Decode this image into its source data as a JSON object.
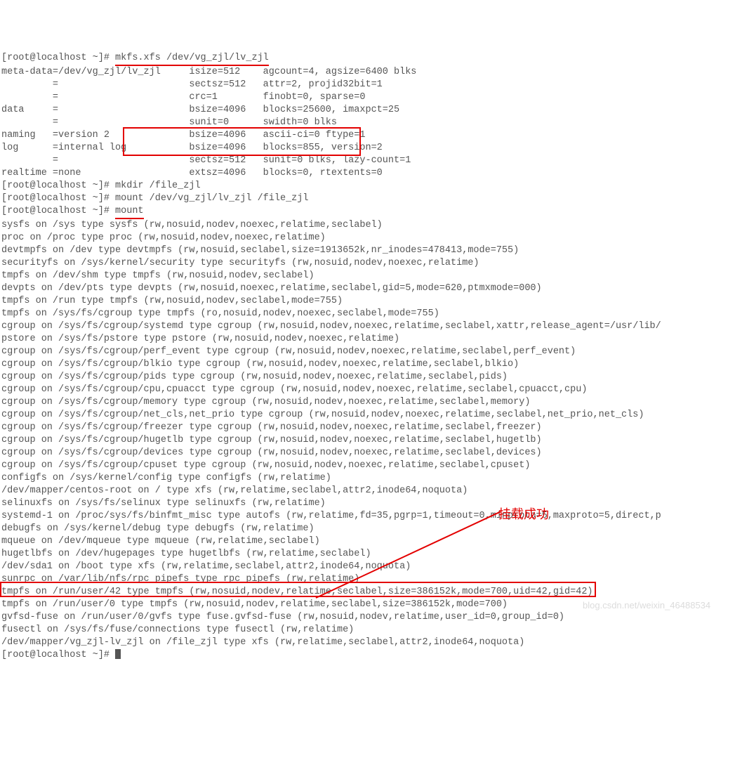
{
  "prompt": "[root@localhost ~]#",
  "cmd_mkfs": "mkfs.xfs /dev/vg_zjl/lv_zjl",
  "mkfs_output": [
    "meta-data=/dev/vg_zjl/lv_zjl     isize=512    agcount=4, agsize=6400 blks",
    "         =                       sectsz=512   attr=2, projid32bit=1",
    "         =                       crc=1        finobt=0, sparse=0",
    "data     =                       bsize=4096   blocks=25600, imaxpct=25",
    "         =                       sunit=0      swidth=0 blks",
    "naming   =version 2              bsize=4096   ascii-ci=0 ftype=1",
    "log      =internal log           bsize=4096   blocks=855, version=2",
    "         =                       sectsz=512   sunit=0 blks, lazy-count=1",
    "realtime =none                   extsz=4096   blocks=0, rtextents=0"
  ],
  "cmd_mkdir": "mkdir /file_zjl",
  "cmd_mount_dev": "mount /dev/vg_zjl/lv_zjl /file_zjl",
  "cmd_mount": "mount",
  "mount_output": [
    "sysfs on /sys type sysfs (rw,nosuid,nodev,noexec,relatime,seclabel)",
    "proc on /proc type proc (rw,nosuid,nodev,noexec,relatime)",
    "devtmpfs on /dev type devtmpfs (rw,nosuid,seclabel,size=1913652k,nr_inodes=478413,mode=755)",
    "securityfs on /sys/kernel/security type securityfs (rw,nosuid,nodev,noexec,relatime)",
    "tmpfs on /dev/shm type tmpfs (rw,nosuid,nodev,seclabel)",
    "devpts on /dev/pts type devpts (rw,nosuid,noexec,relatime,seclabel,gid=5,mode=620,ptmxmode=000)",
    "tmpfs on /run type tmpfs (rw,nosuid,nodev,seclabel,mode=755)",
    "tmpfs on /sys/fs/cgroup type tmpfs (ro,nosuid,nodev,noexec,seclabel,mode=755)",
    "cgroup on /sys/fs/cgroup/systemd type cgroup (rw,nosuid,nodev,noexec,relatime,seclabel,xattr,release_agent=/usr/lib/",
    "pstore on /sys/fs/pstore type pstore (rw,nosuid,nodev,noexec,relatime)",
    "cgroup on /sys/fs/cgroup/perf_event type cgroup (rw,nosuid,nodev,noexec,relatime,seclabel,perf_event)",
    "cgroup on /sys/fs/cgroup/blkio type cgroup (rw,nosuid,nodev,noexec,relatime,seclabel,blkio)",
    "cgroup on /sys/fs/cgroup/pids type cgroup (rw,nosuid,nodev,noexec,relatime,seclabel,pids)",
    "cgroup on /sys/fs/cgroup/cpu,cpuacct type cgroup (rw,nosuid,nodev,noexec,relatime,seclabel,cpuacct,cpu)",
    "cgroup on /sys/fs/cgroup/memory type cgroup (rw,nosuid,nodev,noexec,relatime,seclabel,memory)",
    "cgroup on /sys/fs/cgroup/net_cls,net_prio type cgroup (rw,nosuid,nodev,noexec,relatime,seclabel,net_prio,net_cls)",
    "cgroup on /sys/fs/cgroup/freezer type cgroup (rw,nosuid,nodev,noexec,relatime,seclabel,freezer)",
    "cgroup on /sys/fs/cgroup/hugetlb type cgroup (rw,nosuid,nodev,noexec,relatime,seclabel,hugetlb)",
    "cgroup on /sys/fs/cgroup/devices type cgroup (rw,nosuid,nodev,noexec,relatime,seclabel,devices)",
    "cgroup on /sys/fs/cgroup/cpuset type cgroup (rw,nosuid,nodev,noexec,relatime,seclabel,cpuset)",
    "configfs on /sys/kernel/config type configfs (rw,relatime)",
    "/dev/mapper/centos-root on / type xfs (rw,relatime,seclabel,attr2,inode64,noquota)",
    "selinuxfs on /sys/fs/selinux type selinuxfs (rw,relatime)",
    "systemd-1 on /proc/sys/fs/binfmt_misc type autofs (rw,relatime,fd=35,pgrp=1,timeout=0,minproto=5,maxproto=5,direct,p",
    "debugfs on /sys/kernel/debug type debugfs (rw,relatime)",
    "mqueue on /dev/mqueue type mqueue (rw,relatime,seclabel)",
    "hugetlbfs on /dev/hugepages type hugetlbfs (rw,relatime,seclabel)",
    "/dev/sda1 on /boot type xfs (rw,relatime,seclabel,attr2,inode64,noquota)",
    "sunrpc on /var/lib/nfs/rpc_pipefs type rpc_pipefs (rw,relatime)",
    "tmpfs on /run/user/42 type tmpfs (rw,nosuid,nodev,relatime,seclabel,size=386152k,mode=700,uid=42,gid=42)",
    "tmpfs on /run/user/0 type tmpfs (rw,nosuid,nodev,relatime,seclabel,size=386152k,mode=700)",
    "gvfsd-fuse on /run/user/0/gvfs type fuse.gvfsd-fuse (rw,nosuid,nodev,relatime,user_id=0,group_id=0)",
    "fusectl on /sys/fs/fuse/connections type fusectl (rw,relatime)"
  ],
  "mount_target_line": "/dev/mapper/vg_zjl-lv_zjl on /file_zjl type xfs (rw,relatime,seclabel,attr2,inode64,noquota)",
  "annotation_text": "挂载成功",
  "watermark_text": "blog.csdn.net/weixin_46488534"
}
